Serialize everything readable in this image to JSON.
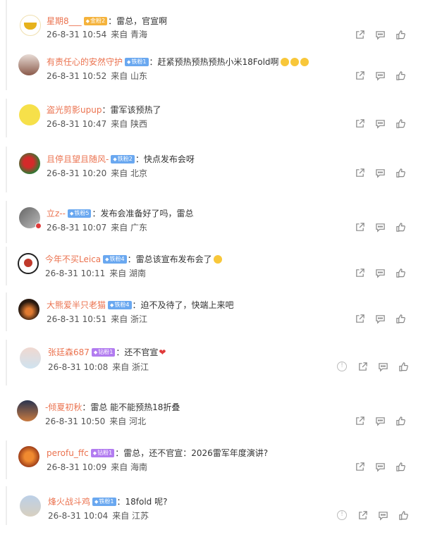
{
  "comments": [
    {
      "user": "星期8___",
      "badge": "金粉2",
      "badge_type": "gold",
      "text": "：雷总，官宣啊",
      "time": "26-8-31 10:54",
      "source": "来自 青海"
    },
    {
      "user": "有责任心的安然守护",
      "badge": "铁粉1",
      "badge_type": "blue",
      "text": "：赶紧预热预热预热小米18Fold啊",
      "time": "26-8-31 10:52",
      "source": "来自 山东"
    },
    {
      "user": "盗光剪影upup",
      "badge": "",
      "badge_type": "",
      "text": "：雷军该预热了",
      "time": "26-8-31 10:47",
      "source": "来自 陕西"
    },
    {
      "user": "且停且望且随风-",
      "badge": "铁粉2",
      "badge_type": "blue",
      "text": "：快点发布会呀",
      "time": "26-8-31 10:20",
      "source": "来自 北京"
    },
    {
      "user": "立z--",
      "badge": "铁粉5",
      "badge_type": "blue",
      "text": "：发布会准备好了吗，雷总",
      "time": "26-8-31 10:07",
      "source": "来自 广东"
    },
    {
      "user": "今年不买Leica",
      "badge": "铁粉4",
      "badge_type": "blue",
      "text": "：雷总该宣布发布会了",
      "time": "26-8-31 10:11",
      "source": "来自 湖南"
    },
    {
      "user": "大熊爱半只老猫",
      "badge": "铁粉4",
      "badge_type": "blue",
      "text": "：迫不及待了，快端上来吧",
      "time": "26-8-31 10:51",
      "source": "来自 浙江"
    },
    {
      "user": "张廷森687",
      "badge": "钻粉1",
      "badge_type": "purple",
      "text": "：还不官宣",
      "time": "26-8-31 10:08",
      "source": "来自 浙江"
    },
    {
      "user": "-倾夏初秋",
      "badge": "",
      "badge_type": "",
      "text": "：雷总 能不能预热18折叠",
      "time": "26-8-31 10:50",
      "source": "来自 河北"
    },
    {
      "user": "perofu_ffc",
      "badge": "钻粉1",
      "badge_type": "purple",
      "text": "：雷总，还不官宣：2026雷军年度演讲?",
      "time": "26-8-31 10:09",
      "source": "来自 海南"
    },
    {
      "user": "烽火战斗鸡",
      "badge": "铁粉1",
      "badge_type": "blue",
      "text": "：18fold 呢?",
      "time": "26-8-31 10:04",
      "source": "来自 江苏"
    }
  ],
  "icons": {
    "share": "share-icon",
    "comment": "comment-icon",
    "like": "like-icon",
    "report": "report-icon"
  },
  "colors": {
    "username": "#eb7350",
    "badge_gold": "#f5b33c",
    "badge_blue": "#6aa8f0",
    "badge_purple": "#b27cf0"
  }
}
